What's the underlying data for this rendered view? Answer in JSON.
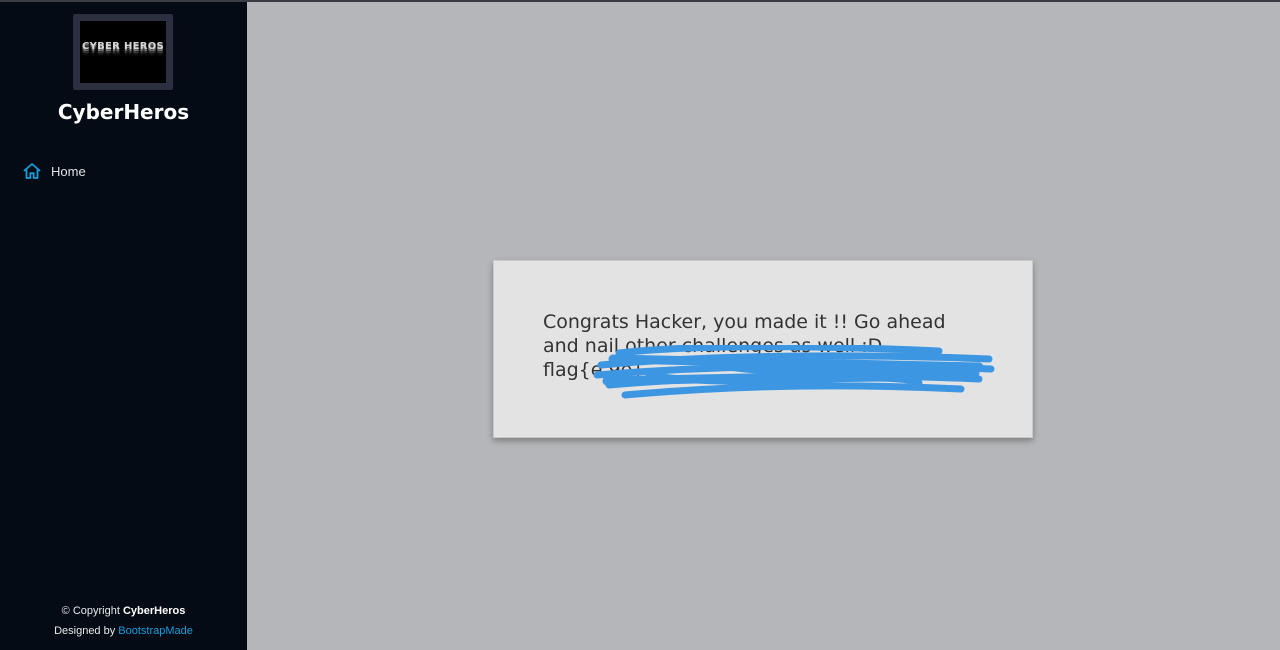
{
  "sidebar": {
    "logo_text": "CYBER HEROS",
    "site_title": "CyberHeros",
    "nav": [
      {
        "label": "Home",
        "icon": "home-icon"
      }
    ],
    "footer": {
      "copyright_prefix": "© Copyright ",
      "copyright_brand": "CyberHeros",
      "designed_by": "Designed by ",
      "designer_link": "BootstrapMade"
    }
  },
  "main": {
    "message": {
      "line1": "Congrats Hacker, you made it !! Go ahead",
      "line2": "and nail other challenges as well :D",
      "line3": "flag{e                                                        9e}"
    }
  },
  "colors": {
    "sidebar_bg": "#040b14",
    "main_bg": "#b5b6b9",
    "card_bg": "#e3e3e3",
    "accent": "#149ddd",
    "redaction": "#3d96e2"
  }
}
